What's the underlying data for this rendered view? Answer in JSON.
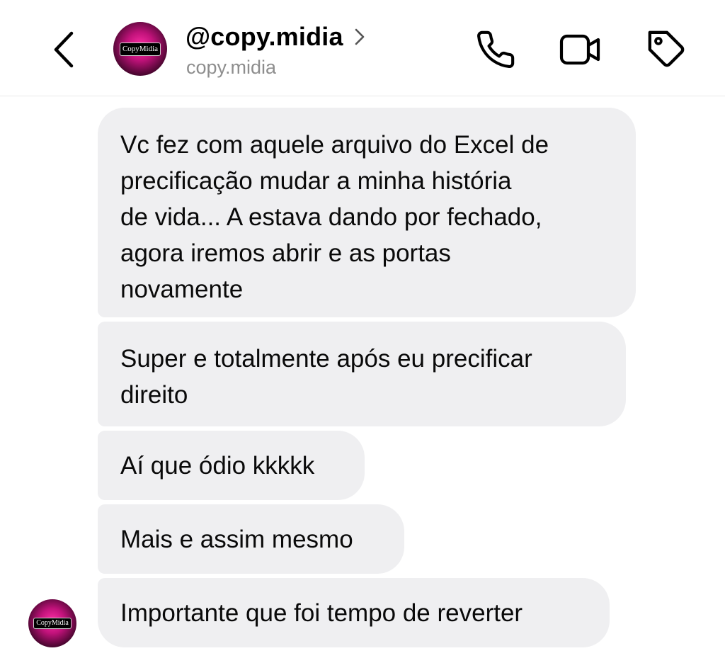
{
  "header": {
    "display_name": "@copy.midia",
    "username": "copy.midia",
    "avatar_logo_text": "CopyMidia",
    "icons": {
      "back": "chevron-left-icon",
      "name_chevron": "chevron-right-icon",
      "call": "phone-icon",
      "video": "video-camera-icon",
      "tag": "tag-icon"
    }
  },
  "messages": [
    {
      "lines": [
        "Vc fez com aquele arquivo do Excel de",
        "precificação mudar a minha história",
        "de vida... A estava dando por fechado,",
        "agora iremos abrir e as portas",
        "novamente"
      ]
    },
    {
      "lines": [
        "Super e totalmente após eu precificar",
        "direito"
      ]
    },
    {
      "lines": [
        "Aí que ódio kkkkk"
      ]
    },
    {
      "lines": [
        "Mais e assim mesmo"
      ]
    },
    {
      "lines": [
        "Importante que foi tempo de reverter"
      ]
    }
  ],
  "sender_avatar_logo_text": "CopyMidia",
  "colors": {
    "bubble_background": "#efeff1",
    "secondary_text": "#8e8e8e",
    "avatar_accent": "#c0127a"
  }
}
